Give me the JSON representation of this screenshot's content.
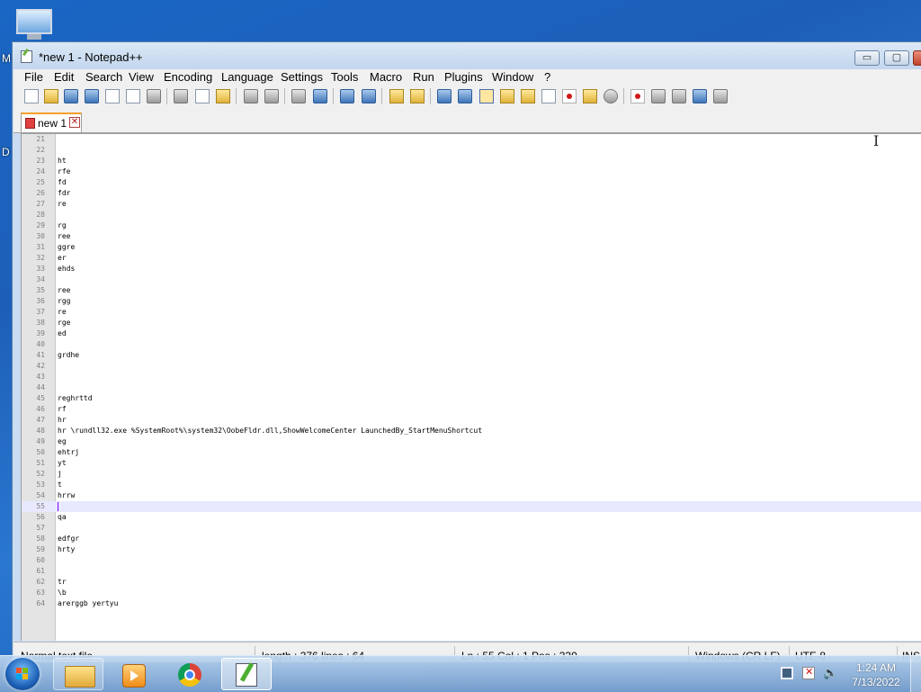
{
  "desktop": {
    "letters": [
      "M",
      "D"
    ]
  },
  "window": {
    "title": "*new 1 - Notepad++",
    "controls": {
      "minimize": "▭",
      "maximize": "▢",
      "close": "✕"
    }
  },
  "menu": [
    "File",
    "Edit",
    "Search",
    "View",
    "Encoding",
    "Language",
    "Settings",
    "Tools",
    "Macro",
    "Run",
    "Plugins",
    "Window",
    "?"
  ],
  "tab": {
    "label": "new 1",
    "close": "✕"
  },
  "editor": {
    "current_line": 55,
    "lines": [
      {
        "n": "21",
        "t": ""
      },
      {
        "n": "22",
        "t": ""
      },
      {
        "n": "23",
        "t": "ht"
      },
      {
        "n": "24",
        "t": "rfe"
      },
      {
        "n": "25",
        "t": "fd"
      },
      {
        "n": "26",
        "t": "fdr"
      },
      {
        "n": "27",
        "t": "re"
      },
      {
        "n": "28",
        "t": ""
      },
      {
        "n": "29",
        "t": "rg"
      },
      {
        "n": "30",
        "t": "ree"
      },
      {
        "n": "31",
        "t": "ggre"
      },
      {
        "n": "32",
        "t": "er"
      },
      {
        "n": "33",
        "t": "ehds"
      },
      {
        "n": "34",
        "t": ""
      },
      {
        "n": "35",
        "t": "ree"
      },
      {
        "n": "36",
        "t": "rgg"
      },
      {
        "n": "37",
        "t": "re"
      },
      {
        "n": "38",
        "t": "rge"
      },
      {
        "n": "39",
        "t": "ed"
      },
      {
        "n": "40",
        "t": ""
      },
      {
        "n": "41",
        "t": "grdhe"
      },
      {
        "n": "42",
        "t": ""
      },
      {
        "n": "43",
        "t": ""
      },
      {
        "n": "44",
        "t": ""
      },
      {
        "n": "45",
        "t": "reghrttd"
      },
      {
        "n": "46",
        "t": "rf"
      },
      {
        "n": "47",
        "t": "hr"
      },
      {
        "n": "48",
        "t": "hr \\rundll32.exe %SystemRoot%\\system32\\OobeFldr.dll,ShowWelcomeCenter LaunchedBy_StartMenuShortcut"
      },
      {
        "n": "49",
        "t": "eg"
      },
      {
        "n": "50",
        "t": "ehtrj"
      },
      {
        "n": "51",
        "t": "yt"
      },
      {
        "n": "52",
        "t": "j"
      },
      {
        "n": "53",
        "t": "t"
      },
      {
        "n": "54",
        "t": "hrrw"
      },
      {
        "n": "55",
        "t": ""
      },
      {
        "n": "56",
        "t": "qa"
      },
      {
        "n": "57",
        "t": ""
      },
      {
        "n": "58",
        "t": "edfgr"
      },
      {
        "n": "59",
        "t": "hrty"
      },
      {
        "n": "60",
        "t": ""
      },
      {
        "n": "61",
        "t": ""
      },
      {
        "n": "62",
        "t": "tr"
      },
      {
        "n": "63",
        "t": "\\b"
      },
      {
        "n": "64",
        "t": "arerggb yertyu"
      }
    ]
  },
  "status": {
    "file_type": "Normal text file",
    "length": "length : 376    lines : 64",
    "position": "Ln : 55    Col : 1    Pos : 330",
    "eol": "Windows (CR LF)",
    "encoding": "UTF-8",
    "mode": "INS"
  },
  "taskbar": {
    "apps": [
      {
        "name": "file-explorer",
        "active": false
      },
      {
        "name": "media-player",
        "active": false
      },
      {
        "name": "chrome",
        "active": false
      },
      {
        "name": "notepad-plus-plus",
        "active": true
      }
    ],
    "clock_time": "1:24 AM",
    "clock_date": "7/13/2022",
    "volume_glyph": "🔈"
  }
}
